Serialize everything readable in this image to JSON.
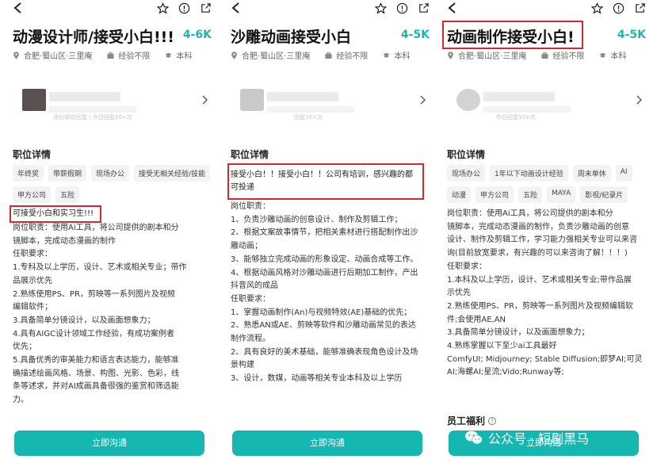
{
  "panels": [
    {
      "title": "动漫设计师/接受小白!!!",
      "salary": "4-6K",
      "location": "合肥·蜀山区·三里庵",
      "experience": "经验不限",
      "education": "本科",
      "recruiter_text": "刚分钟前回复 | 今日回复10+次",
      "section_title": "职位详情",
      "tags": [
        "年终奖",
        "带薪假期",
        "现场办公",
        "接受无相关经验/技能",
        "甲方公司",
        "五险"
      ],
      "highlight": "可接受小白和实习生!!!",
      "lines": [
        "岗位职责：使用Ai工具，将公司提供的剧本和分",
        "镜脚本，完成动态漫画的制作",
        "任职要求：",
        "1.专科及以上学历，设计、艺术或相关专业；带作",
        "品展示优先",
        "2.熟练使用PS、PR，剪映等一系列图片及视频",
        "编辑软件；",
        "3.具备简单分镜设计，以及画面想象力；",
        "4.具有AIGC设计领域工作经验，有成功案例者",
        "优先；",
        "5.具备优秀的审美能力和语言表达能力，能够准",
        "确描述绘画风格、场景、构图、光影、色彩，线",
        "条等述求，并对AI成画具备很强的鉴赏和筛选能",
        "力。"
      ],
      "button": "立即沟通"
    },
    {
      "title": "沙雕动画接受小白",
      "salary": "4-5K",
      "location": "合肥·蜀山区·三里庵",
      "experience": "经验不限",
      "education": "本科",
      "recruiter_text": "回复10+次",
      "section_title": "职位详情",
      "highlight_lines": [
        "接受小白！！接受小白！！公司有培训，感兴趣的都",
        "可投递"
      ],
      "lines": [
        "岗位职责：",
        "1、负责沙雕动画的创意设计、制作及剪辑工作；",
        "2、根据文案故事情节，把相关素材进行搭配制作出沙",
        "雕动画；",
        "3、能够独立完成动画的形象设定、动画合成等工作。",
        "4、根据动画风格对沙雕动画进行后期加工制作，产出",
        "抖音风的成品",
        "任职要求：",
        "1、掌握动画制作(An)与视频特效(AE)基础的优先；",
        "2、熟悉AN或AE、剪映等软件和沙雕动画常见的表达",
        "制作流程。",
        "2、具有良好的美术基础，能够准确表现角色设计及场",
        "景构建",
        "3、设计，数媒，动画等相关专业本科及以上学历"
      ],
      "button": "立即沟通"
    },
    {
      "title": "动画制作接受小白!",
      "salary": "4-5K",
      "location": "合肥·蜀山区·三里庵",
      "experience": "经验不限",
      "education": "本科",
      "recruiter_text": "今日回复10+次",
      "section_title": "职位详情",
      "tags": [
        "现场办公",
        "1年以下动画设计经验",
        "周末单休",
        "AI",
        "动漫",
        "甲方公司",
        "五险",
        "MAYA",
        "影视/纪录片"
      ],
      "lines": [
        "岗位职责：使用Ai工具，将公司提供的剧本和分",
        "镜脚本，完成动态漫画的制作，负责沙雕动画的创意",
        "设计、制作及剪辑工作，学习能力强相关专业可以来咨",
        "询(目前放宽要求，有兴趣的可以来咨询了解！！！)",
        "任职要求：",
        "1.本科及以上学历，设计、艺术或相关专业;带作品展",
        "示优先",
        "2.熟练使用PS、PR，剪映等一系列图片及视频编辑软",
        "件;会使用AE,AN",
        "3.具备简单分镜设计，以及画面想象力；",
        "4.熟练掌握以下至少ai工具最好",
        "ComfyUI; Midjourney; Stable Diffusion;即梦AI;可灵",
        "AI;海螺AI;星流;Vido;Runway等;"
      ],
      "benefits": "员工福利",
      "button": "立即沟通"
    }
  ],
  "watermark": "公众号 · 短剧黑马",
  "colors": {
    "accent": "#1fb5b0",
    "button": "#17b7b1",
    "highlight": "#d6282e"
  }
}
